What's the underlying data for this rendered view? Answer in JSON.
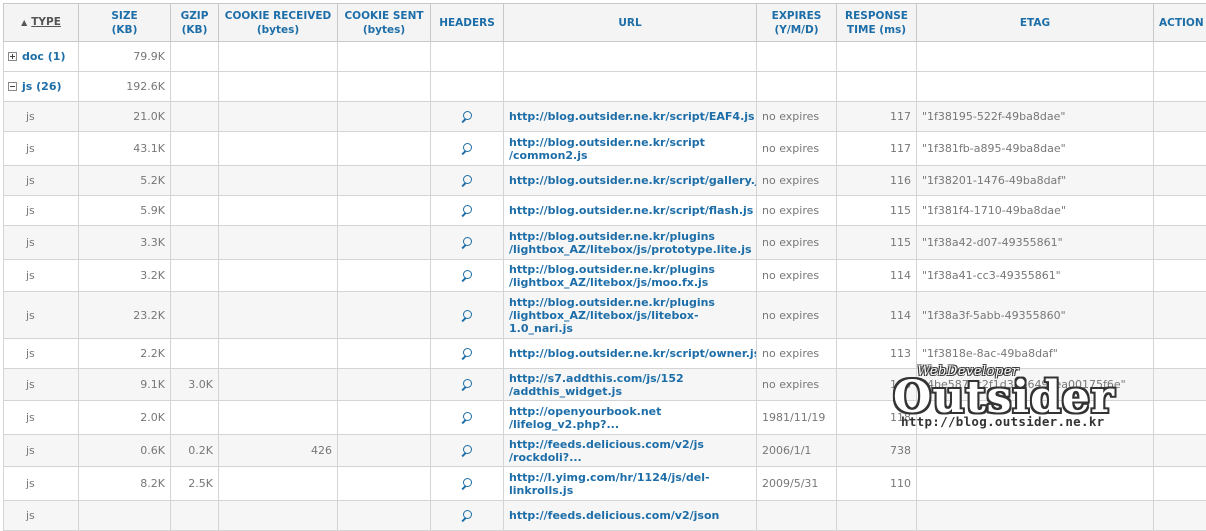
{
  "columns": {
    "type": "TYPE",
    "size": "SIZE\n(KB)",
    "gzip": "GZIP\n(KB)",
    "cookie_received": "COOKIE RECEIVED\n(bytes)",
    "cookie_sent": "COOKIE SENT\n(bytes)",
    "headers": "HEADERS",
    "url": "URL",
    "expires": "EXPIRES\n(Y/M/D)",
    "response_time": "RESPONSE\nTIME (ms)",
    "etag": "ETAG",
    "action": "ACTION"
  },
  "groups": [
    {
      "label": "doc (1)",
      "size": "79.9K",
      "expanded": false
    },
    {
      "label": "js (26)",
      "size": "192.6K",
      "expanded": true
    }
  ],
  "rows": [
    {
      "type": "js",
      "size": "21.0K",
      "gzip": "",
      "cookie_received": "",
      "cookie_sent": "",
      "url": "http://blog.outsider.ne.kr/script/EAF4.js",
      "expires": "no expires",
      "response_time": "117",
      "etag": "\"1f38195-522f-49ba8dae\""
    },
    {
      "type": "js",
      "size": "43.1K",
      "gzip": "",
      "cookie_received": "",
      "cookie_sent": "",
      "url": "http://blog.outsider.ne.kr/script\n/common2.js",
      "expires": "no expires",
      "response_time": "117",
      "etag": "\"1f381fb-a895-49ba8dae\""
    },
    {
      "type": "js",
      "size": "5.2K",
      "gzip": "",
      "cookie_received": "",
      "cookie_sent": "",
      "url": "http://blog.outsider.ne.kr/script/gallery.js",
      "expires": "no expires",
      "response_time": "116",
      "etag": "\"1f38201-1476-49ba8daf\""
    },
    {
      "type": "js",
      "size": "5.9K",
      "gzip": "",
      "cookie_received": "",
      "cookie_sent": "",
      "url": "http://blog.outsider.ne.kr/script/flash.js",
      "expires": "no expires",
      "response_time": "115",
      "etag": "\"1f381f4-1710-49ba8dae\""
    },
    {
      "type": "js",
      "size": "3.3K",
      "gzip": "",
      "cookie_received": "",
      "cookie_sent": "",
      "url": "http://blog.outsider.ne.kr/plugins\n/lightbox_AZ/litebox/js/prototype.lite.js",
      "expires": "no expires",
      "response_time": "115",
      "etag": "\"1f38a42-d07-49355861\""
    },
    {
      "type": "js",
      "size": "3.2K",
      "gzip": "",
      "cookie_received": "",
      "cookie_sent": "",
      "url": "http://blog.outsider.ne.kr/plugins\n/lightbox_AZ/litebox/js/moo.fx.js",
      "expires": "no expires",
      "response_time": "114",
      "etag": "\"1f38a41-cc3-49355861\""
    },
    {
      "type": "js",
      "size": "23.2K",
      "gzip": "",
      "cookie_received": "",
      "cookie_sent": "",
      "url": "http://blog.outsider.ne.kr/plugins\n/lightbox_AZ/litebox/js/litebox-\n1.0_nari.js",
      "expires": "no expires",
      "response_time": "114",
      "etag": "\"1f38a3f-5abb-49355860\""
    },
    {
      "type": "js",
      "size": "2.2K",
      "gzip": "",
      "cookie_received": "",
      "cookie_sent": "",
      "url": "http://blog.outsider.ne.kr/script/owner.js",
      "expires": "no expires",
      "response_time": "113",
      "etag": "\"1f3818e-8ac-49ba8daf\""
    },
    {
      "type": "js",
      "size": "9.1K",
      "gzip": "3.0K",
      "cookie_received": "",
      "cookie_sent": "",
      "url": "http://s7.addthis.com/js/152\n/addthis_widget.js",
      "expires": "no expires",
      "response_time": "113",
      "etag": "\"4be5876c2f1d3a8649cea00175f6e\""
    },
    {
      "type": "js",
      "size": "2.0K",
      "gzip": "",
      "cookie_received": "",
      "cookie_sent": "",
      "url": "http://openyourbook.net\n/lifelog_v2.php?...",
      "expires": "1981/11/19",
      "response_time": "118",
      "etag": ""
    },
    {
      "type": "js",
      "size": "0.6K",
      "gzip": "0.2K",
      "cookie_received": "426",
      "cookie_sent": "",
      "url": "http://feeds.delicious.com/v2/js\n/rockdoli?...",
      "expires": "2006/1/1",
      "response_time": "738",
      "etag": ""
    },
    {
      "type": "js",
      "size": "8.2K",
      "gzip": "2.5K",
      "cookie_received": "",
      "cookie_sent": "",
      "url": "http://l.yimg.com/hr/1124/js/del-\nlinkrolls.js",
      "expires": "2009/5/31",
      "response_time": "110",
      "etag": ""
    },
    {
      "type": "js",
      "size": "",
      "gzip": "",
      "cookie_received": "",
      "cookie_sent": "",
      "url": "http://feeds.delicious.com/v2/json",
      "expires": "",
      "response_time": "",
      "etag": ""
    }
  ],
  "watermark": {
    "tagline": "WebDeveloper",
    "name": "Outsider",
    "site": "http://blog.outsider.ne.kr"
  }
}
